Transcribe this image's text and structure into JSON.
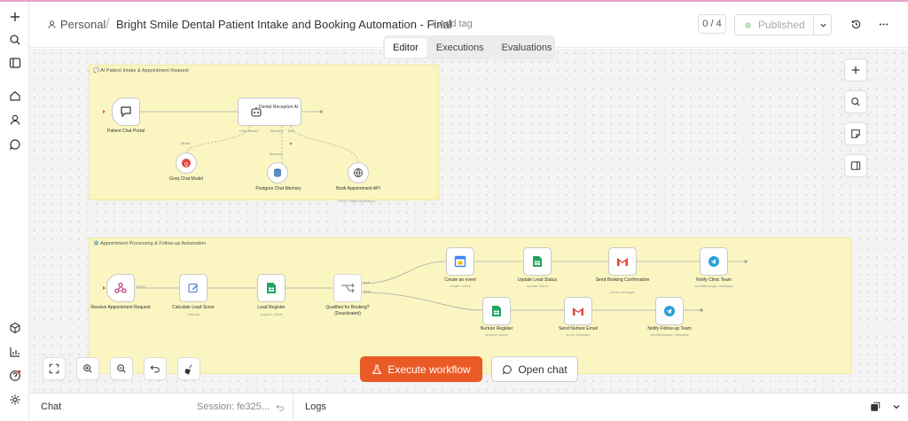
{
  "header": {
    "project": "Personal",
    "separator": "/",
    "title": "Bright Smile Dental Patient Intake and Booking Automation - Final",
    "add_tag": "+ Add tag",
    "count": "0 / 4",
    "publish_label": "Published"
  },
  "tabs": [
    {
      "label": "Editor",
      "active": true
    },
    {
      "label": "Executions",
      "active": false
    },
    {
      "label": "Evaluations",
      "active": false
    }
  ],
  "sticky1": {
    "title": "💬 AI Patient Intake & Appointment Request"
  },
  "sticky2": {
    "title": "⚙️ Appointment Processing & Follow-up Automation"
  },
  "nodes1": {
    "chat_portal": "Patient Chat Portal",
    "agent": "Dental Reception AI",
    "groq": "Groq Chat Model",
    "memory": "Postgres Chat Memory",
    "book_api": "Book Appointment API",
    "book_api_sub": "POST: https://primary-p...",
    "port_chat_model": "Chat Model*",
    "port_memory": "Memory",
    "port_tool": "Tool",
    "edge_model": "Model",
    "edge_memory": "Memory",
    "edge_tool": "Tool"
  },
  "nodes2": {
    "webhook": "Receive Appointment Request",
    "webhook_edge": "POST",
    "lead_score": "Calculate Lead Score",
    "lead_score_sub": "manual",
    "lead_register": "Lead Register",
    "lead_register_sub": "append: sheet",
    "qualified": "Qualified for Booking?",
    "qualified_note": "(Deactivated)",
    "true_label": "true",
    "false_label": "false",
    "create_event": "Create an event",
    "create_event_sub": "create: event",
    "update_lead": "Update Lead Status",
    "update_lead_sub": "update: sheet",
    "send_conf": "Send Booking Confirmation",
    "send_conf_sub": "send: message",
    "notify_clinic": "Notify Clinic Team",
    "notify_clinic_sub": "sendMessage: message",
    "nurture_reg": "Nurture Register",
    "nurture_reg_sub": "append: sheet",
    "send_nurture": "Send Nurture Email",
    "send_nurture_sub": "send: message",
    "notify_followup": "Notify Follow-up Team",
    "notify_followup_sub": "sendMessage: message"
  },
  "actions": {
    "execute": "Execute workflow",
    "open_chat": "Open chat"
  },
  "bottom": {
    "chat": "Chat",
    "session": "Session: fe325...",
    "logs": "Logs"
  },
  "colors": {
    "accent": "#ea5a26",
    "sticky": "#fbf5c2",
    "sheets_green": "#1fa463",
    "telegram": "#2a9fd8",
    "groq": "#e2473e",
    "webhook": "#c1408c"
  }
}
